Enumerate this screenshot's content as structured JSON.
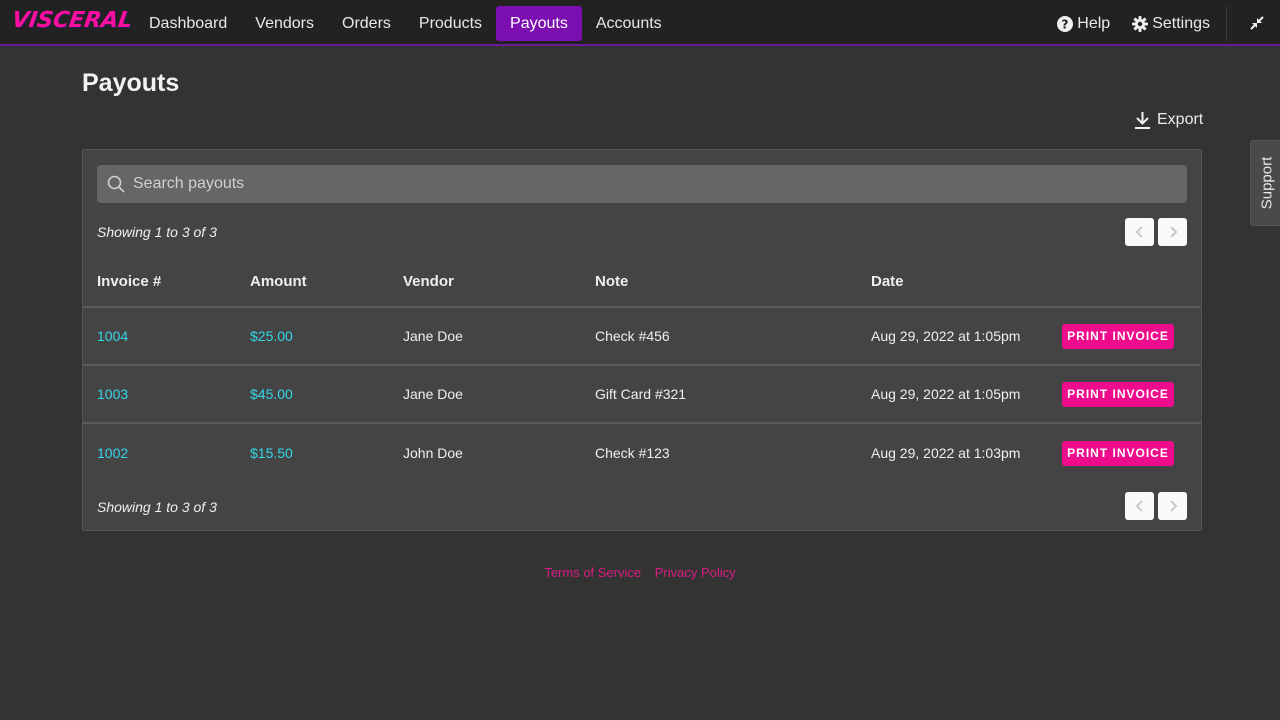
{
  "brand": {
    "logo_text": "VISCERAL",
    "accent": "#ff0fa0",
    "nav_active_color": "#7b0fb0",
    "link_color": "#35d6e8"
  },
  "nav": {
    "items": [
      {
        "label": "Dashboard",
        "active": false
      },
      {
        "label": "Vendors",
        "active": false
      },
      {
        "label": "Orders",
        "active": false
      },
      {
        "label": "Products",
        "active": false
      },
      {
        "label": "Payouts",
        "active": true
      },
      {
        "label": "Accounts",
        "active": false
      }
    ],
    "help_label": "Help",
    "settings_label": "Settings"
  },
  "page": {
    "title": "Payouts",
    "export_label": "Export",
    "support_label": "Support"
  },
  "search": {
    "placeholder": "Search payouts",
    "value": ""
  },
  "pagination": {
    "showing_top": "Showing 1 to 3 of 3",
    "showing_bottom": "Showing 1 to 3 of 3"
  },
  "table": {
    "columns": [
      "Invoice #",
      "Amount",
      "Vendor",
      "Note",
      "Date"
    ],
    "rows": [
      {
        "invoice": "1004",
        "amount": "$25.00",
        "vendor": "Jane Doe",
        "note": "Check #456",
        "date": "Aug 29, 2022 at 1:05pm",
        "action": "PRINT INVOICE"
      },
      {
        "invoice": "1003",
        "amount": "$45.00",
        "vendor": "Jane Doe",
        "note": "Gift Card #321",
        "date": "Aug 29, 2022 at 1:05pm",
        "action": "PRINT INVOICE"
      },
      {
        "invoice": "1002",
        "amount": "$15.50",
        "vendor": "John Doe",
        "note": "Check #123",
        "date": "Aug 29, 2022 at 1:03pm",
        "action": "PRINT INVOICE"
      }
    ]
  },
  "footer": {
    "links": [
      "Terms of Service",
      "Privacy Policy"
    ]
  }
}
